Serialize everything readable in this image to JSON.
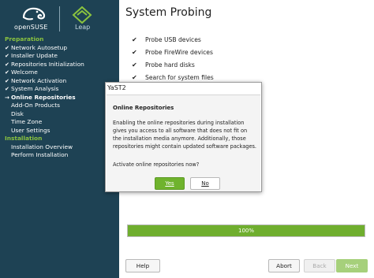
{
  "sidebar": {
    "brand_opensuse": "openSUSE",
    "brand_leap": "Leap",
    "sections": [
      {
        "title": "Preparation",
        "items": [
          {
            "label": "Network Autosetup",
            "mark": "✔"
          },
          {
            "label": "Installer Update",
            "mark": "✔"
          },
          {
            "label": "Repositories Initialization",
            "mark": "✔"
          },
          {
            "label": "Welcome",
            "mark": "✔"
          },
          {
            "label": "Network Activation",
            "mark": "✔"
          },
          {
            "label": "System Analysis",
            "mark": "✔"
          },
          {
            "label": "Online Repositories",
            "mark": "→",
            "current": true
          },
          {
            "label": "Add-On Products",
            "mark": ""
          },
          {
            "label": "Disk",
            "mark": ""
          },
          {
            "label": "Time Zone",
            "mark": ""
          },
          {
            "label": "User Settings",
            "mark": ""
          }
        ]
      },
      {
        "title": "Installation",
        "items": [
          {
            "label": "Installation Overview",
            "mark": ""
          },
          {
            "label": "Perform Installation",
            "mark": ""
          }
        ]
      }
    ]
  },
  "main": {
    "title": "System Probing",
    "steps": [
      {
        "label": "Probe USB devices",
        "mark": "✔"
      },
      {
        "label": "Probe FireWire devices",
        "mark": "✔"
      },
      {
        "label": "Probe hard disks",
        "mark": "✔"
      },
      {
        "label": "Search for system files",
        "mark": "✔"
      }
    ],
    "progress": {
      "value": 1.0,
      "label": "100%"
    }
  },
  "buttons": {
    "help": "Help",
    "abort": "Abort",
    "back": "Back",
    "next": "Next"
  },
  "dialog": {
    "title": "YaST2",
    "heading": "Online Repositories",
    "body_lines": [
      "Enabling the online repositories during installation",
      "gives you access to all software that does not fit on",
      "the installation media anymore. Additionally, those",
      "repositories might contain updated software packages."
    ],
    "question": "Activate online repositories now?",
    "yes_label": "Yes",
    "no_label": "No"
  },
  "colors": {
    "sidebar_bg": "#1e4254",
    "accent_green": "#6fb32d",
    "section_green": "#8ac33f"
  },
  "icons": {
    "opensuse_logo": "chameleon-icon",
    "leap_logo": "leap-diamond-icon"
  }
}
